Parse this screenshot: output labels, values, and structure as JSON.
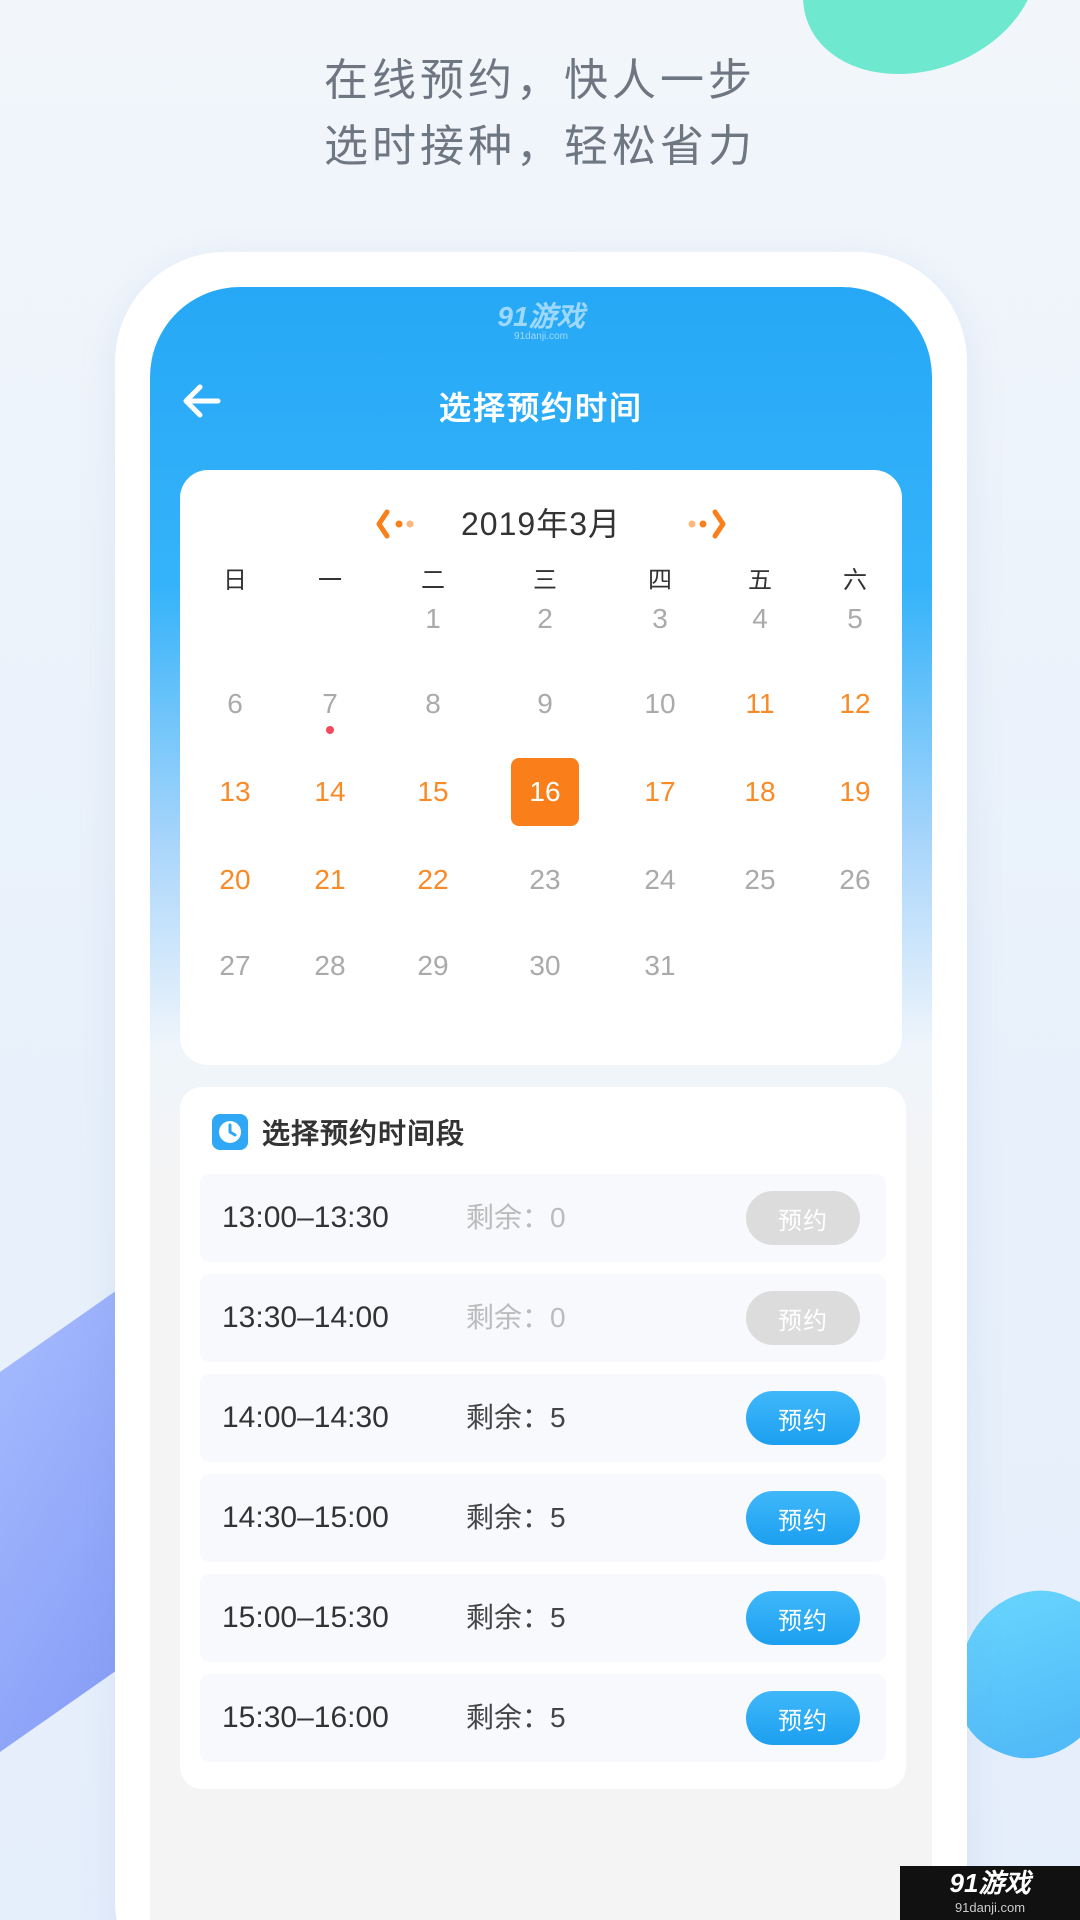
{
  "slogan": {
    "line1": "在线预约，快人一步",
    "line2": "选时接种，轻松省力"
  },
  "status_logo": {
    "main": "91游戏",
    "sub": "91danji.com"
  },
  "header": {
    "title": "选择预约时间"
  },
  "calendar": {
    "month_title": "2019年3月",
    "weekdays": [
      "日",
      "一",
      "二",
      "三",
      "四",
      "五",
      "六"
    ],
    "selected_day": "16",
    "marked_day": "7",
    "rows": [
      [
        "",
        "",
        "1",
        "2",
        "3",
        "4",
        "5"
      ],
      [
        "6",
        "7",
        "8",
        "9",
        "10",
        "11",
        "12"
      ],
      [
        "13",
        "14",
        "15",
        "16",
        "17",
        "18",
        "19"
      ],
      [
        "20",
        "21",
        "22",
        "23",
        "24",
        "25",
        "26"
      ],
      [
        "27",
        "28",
        "29",
        "30",
        "31",
        "",
        ""
      ]
    ],
    "available_days": [
      "11",
      "12",
      "13",
      "14",
      "15",
      "16",
      "17",
      "18",
      "19",
      "20",
      "21",
      "22"
    ]
  },
  "slots": {
    "title": "选择预约时间段",
    "items": [
      {
        "time": "13:00–13:30",
        "remain": "剩余：0",
        "button": "预约",
        "enabled": false
      },
      {
        "time": "13:30–14:00",
        "remain": "剩余：0",
        "button": "预约",
        "enabled": false
      },
      {
        "time": "14:00–14:30",
        "remain": "剩余：5",
        "button": "预约",
        "enabled": true
      },
      {
        "time": "14:30–15:00",
        "remain": "剩余：5",
        "button": "预约",
        "enabled": true
      },
      {
        "time": "15:00–15:30",
        "remain": "剩余：5",
        "button": "预约",
        "enabled": true
      },
      {
        "time": "15:30–16:00",
        "remain": "剩余：5",
        "button": "预约",
        "enabled": true
      }
    ]
  },
  "watermark": {
    "main": "91游戏",
    "sub": "91danji.com"
  },
  "colors": {
    "primary_blue": "#26a8f6",
    "accent_orange": "#fa7f1a",
    "available_day": "#fa8a26",
    "unavailable_day": "#aaaaaa",
    "disabled_button": "#dcdcdc",
    "mark_dot": "#f24a5a"
  },
  "icons": {
    "back": "arrow-left-icon",
    "prev_month": "chevron-left-icon",
    "next_month": "chevron-right-icon",
    "slot_header": "clock-icon"
  }
}
